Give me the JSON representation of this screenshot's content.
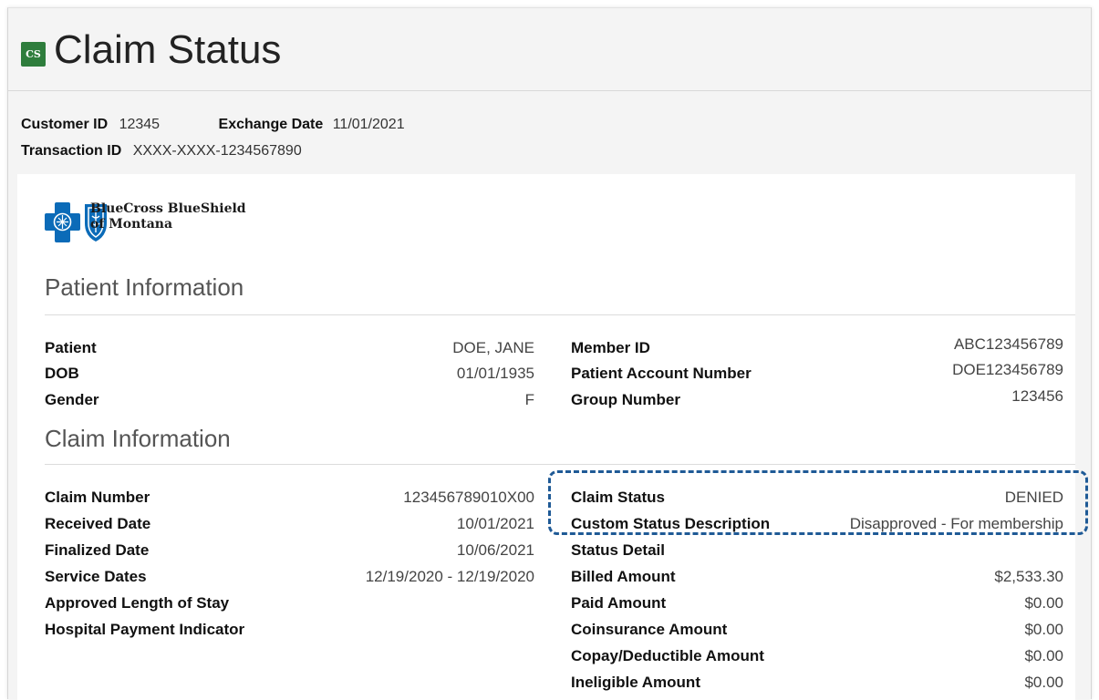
{
  "header": {
    "badge": "CS",
    "title": "Claim Status"
  },
  "meta": {
    "customer_id_label": "Customer ID",
    "customer_id": "12345",
    "exchange_date_label": "Exchange Date",
    "exchange_date": "11/01/2021",
    "transaction_id_label": "Transaction ID",
    "transaction_id": "XXXX-XXXX-1234567890"
  },
  "logo": {
    "line1": "BlueCross BlueShield",
    "line2": "of Montana",
    "brand_color": "#0b6bb8"
  },
  "patient_info": {
    "title": "Patient Information",
    "left": [
      {
        "label": "Patient",
        "value": "DOE, JANE"
      },
      {
        "label": "DOB",
        "value": "01/01/1935"
      },
      {
        "label": "Gender",
        "value": "F"
      }
    ],
    "right": [
      {
        "label": "Member ID",
        "value": "ABC123456789"
      },
      {
        "label": "Patient Account Number",
        "value": "DOE123456789"
      },
      {
        "label": "Group Number",
        "value": "123456"
      }
    ]
  },
  "claim_info": {
    "title": "Claim Information",
    "left": [
      {
        "label": "Claim Number",
        "value": "123456789010X00"
      },
      {
        "label": "Received Date",
        "value": "10/01/2021"
      },
      {
        "label": "Finalized Date",
        "value": "10/06/2021"
      },
      {
        "label": "Service Dates",
        "value": "12/19/2020 - 12/19/2020"
      },
      {
        "label": "Approved Length of Stay",
        "value": ""
      },
      {
        "label": "Hospital Payment Indicator",
        "value": ""
      }
    ],
    "right": [
      {
        "label": "Claim Status",
        "value": "DENIED"
      },
      {
        "label": "Custom Status Description",
        "value": "Disapproved - For membership"
      },
      {
        "label": "Status Detail",
        "value": ""
      },
      {
        "label": "Billed Amount",
        "value": "$2,533.30"
      },
      {
        "label": "Paid Amount",
        "value": "$0.00"
      },
      {
        "label": "Coinsurance Amount",
        "value": "$0.00"
      },
      {
        "label": "Copay/Deductible Amount",
        "value": "$0.00"
      },
      {
        "label": "Ineligible Amount",
        "value": "$0.00"
      }
    ]
  },
  "colors": {
    "badge": "#2e7d3c",
    "highlight_border": "#1f5a96"
  }
}
